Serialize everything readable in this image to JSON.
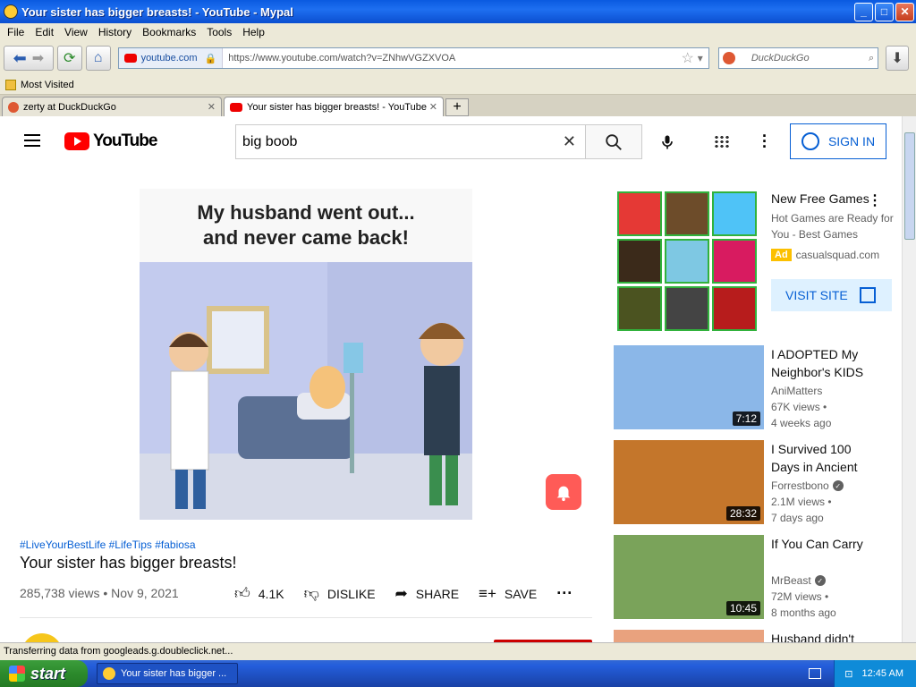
{
  "window": {
    "title": "Your sister has bigger breasts! - YouTube - Mypal"
  },
  "menu": [
    "File",
    "Edit",
    "View",
    "History",
    "Bookmarks",
    "Tools",
    "Help"
  ],
  "nav": {
    "site": "youtube.com",
    "url": "https://www.youtube.com/watch?v=ZNhwVGZXVOA",
    "search_placeholder": "DuckDuckGo"
  },
  "bookmarks": {
    "most_visited": "Most Visited"
  },
  "tabs": [
    {
      "label": "zerty at DuckDuckGo"
    },
    {
      "label": "Your sister has bigger breasts! - YouTube"
    }
  ],
  "youtube": {
    "logo_text": "YouTube",
    "search_value": "big boob",
    "signin_label": "SIGN IN"
  },
  "video": {
    "thumbnail_caption_line1": "My husband went out...",
    "thumbnail_caption_line2": "and never came back!",
    "hashtags": "#LiveYourBestLife #LifeTips #fabiosa",
    "title": "Your sister has bigger breasts!",
    "meta": "285,738 views • Nov 9, 2021",
    "likes": "4.1K",
    "dislike": "DISLIKE",
    "share": "SHARE",
    "save": "SAVE"
  },
  "ad": {
    "title": "New Free Games",
    "description": "Hot Games are Ready for You - Best Games",
    "badge": "Ad",
    "domain": "casualsquad.com",
    "cta": "VISIT SITE",
    "tile_colors": [
      "#e53935",
      "#6d4c2a",
      "#4fc3f7",
      "#3b2a1a",
      "#7ec8e3",
      "#d81b60",
      "#4b5320",
      "#444444",
      "#b71c1c"
    ]
  },
  "recommendations": [
    {
      "title": "I ADOPTED My Neighbor's KIDS",
      "channel": "AniMatters",
      "verified": false,
      "views": "67K views •",
      "age": "4 weeks ago",
      "duration": "7:12",
      "thumb_color": "#8bb7e8"
    },
    {
      "title": "I Survived 100 Days in Ancient",
      "channel": "Forrestbono",
      "verified": true,
      "views": "2.1M views •",
      "age": "7 days ago",
      "duration": "28:32",
      "thumb_color": "#c4762b"
    },
    {
      "title": "If You Can Carry",
      "channel": "MrBeast",
      "verified": true,
      "views": "72M views •",
      "age": "8 months ago",
      "duration": "10:45",
      "thumb_color": "#7aa35a"
    },
    {
      "title": "Husband didn't",
      "channel": "",
      "verified": false,
      "views": "",
      "age": "",
      "duration": "",
      "thumb_color": "#e9a27e"
    }
  ],
  "status": {
    "text": "Transferring data from googleads.g.doubleclick.net..."
  },
  "taskbar": {
    "start": "start",
    "item": "Your sister has bigger ...",
    "clock": "12:45 AM"
  }
}
